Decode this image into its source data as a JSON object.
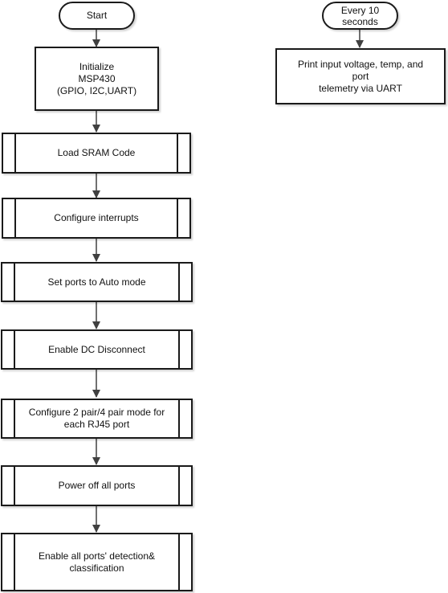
{
  "diagram": {
    "main_flow": {
      "start": "Start",
      "steps": [
        "Initialize\nMSP430\n(GPIO, I2C,UART)",
        "Load SRAM Code",
        "Configure interrupts",
        "Set ports to Auto mode",
        "Enable DC Disconnect",
        "Configure 2 pair/4 pair mode for\neach RJ45 port",
        "Power off all ports",
        "Enable all ports' detection&\nclassification"
      ]
    },
    "periodic_flow": {
      "trigger": "Every 10\nseconds",
      "action": "Print input voltage, temp, and port\ntelemetry via UART"
    },
    "colors": {
      "stroke": "#1a1a1a",
      "arrow": "#404040",
      "fill": "#ffffff"
    }
  }
}
